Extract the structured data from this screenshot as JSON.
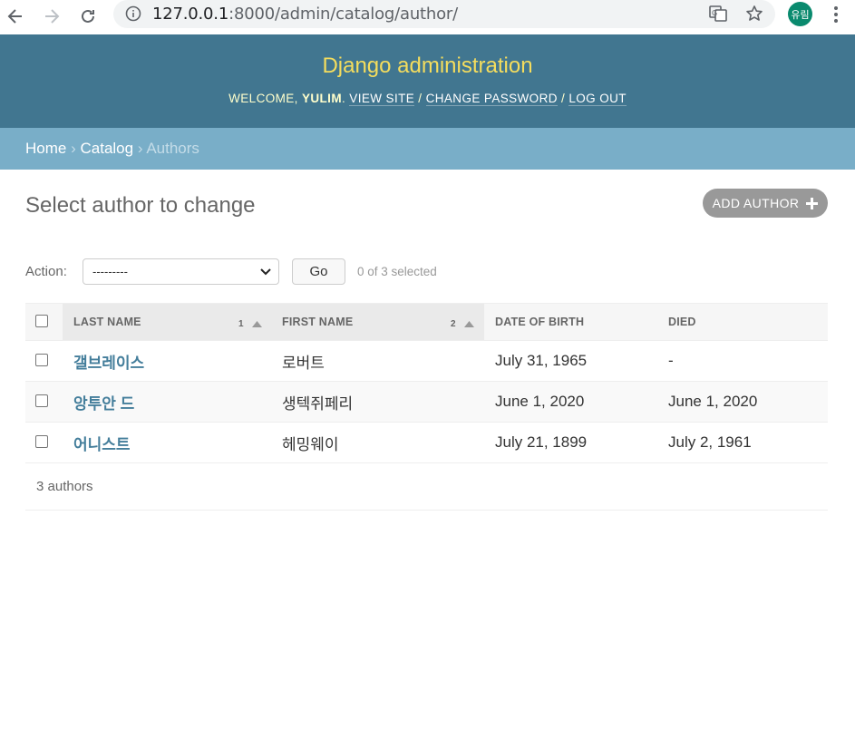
{
  "browser": {
    "url_host": "127.0.0.1",
    "url_rest": ":8000/admin/catalog/author/",
    "profile_label": "유림"
  },
  "header": {
    "site_title": "Django administration",
    "welcome": "Welcome,",
    "username": "yulim",
    "view_site": "View site",
    "change_password": "Change password",
    "log_out": "Log out"
  },
  "breadcrumbs": {
    "home": "Home",
    "catalog": "Catalog",
    "current": "Authors",
    "separator": "›"
  },
  "content": {
    "title": "Select author to change",
    "add_button": "Add author"
  },
  "actions": {
    "label": "Action:",
    "selected_option": "---------",
    "go_label": "Go",
    "selected_count": "0 of 3 selected"
  },
  "table": {
    "columns": [
      {
        "label": "Last name",
        "sort_priority": "1"
      },
      {
        "label": "First name",
        "sort_priority": "2"
      },
      {
        "label": "Date of birth"
      },
      {
        "label": "Died"
      }
    ],
    "rows": [
      {
        "last_name": "갤브레이스",
        "first_name": "로버트",
        "date_of_birth": "July 31, 1965",
        "died": "-"
      },
      {
        "last_name": "앙투안 드",
        "first_name": "생텍쥐페리",
        "date_of_birth": "June 1, 2020",
        "died": "June 1, 2020"
      },
      {
        "last_name": "어니스트",
        "first_name": "헤밍웨이",
        "date_of_birth": "July 21, 1899",
        "died": "July 2, 1961"
      }
    ]
  },
  "paginator": "3 authors",
  "colors": {
    "header_bg": "#417690",
    "breadcrumbs_bg": "#79aec8",
    "site_title": "#f5dd5d",
    "link": "#447e9b"
  }
}
